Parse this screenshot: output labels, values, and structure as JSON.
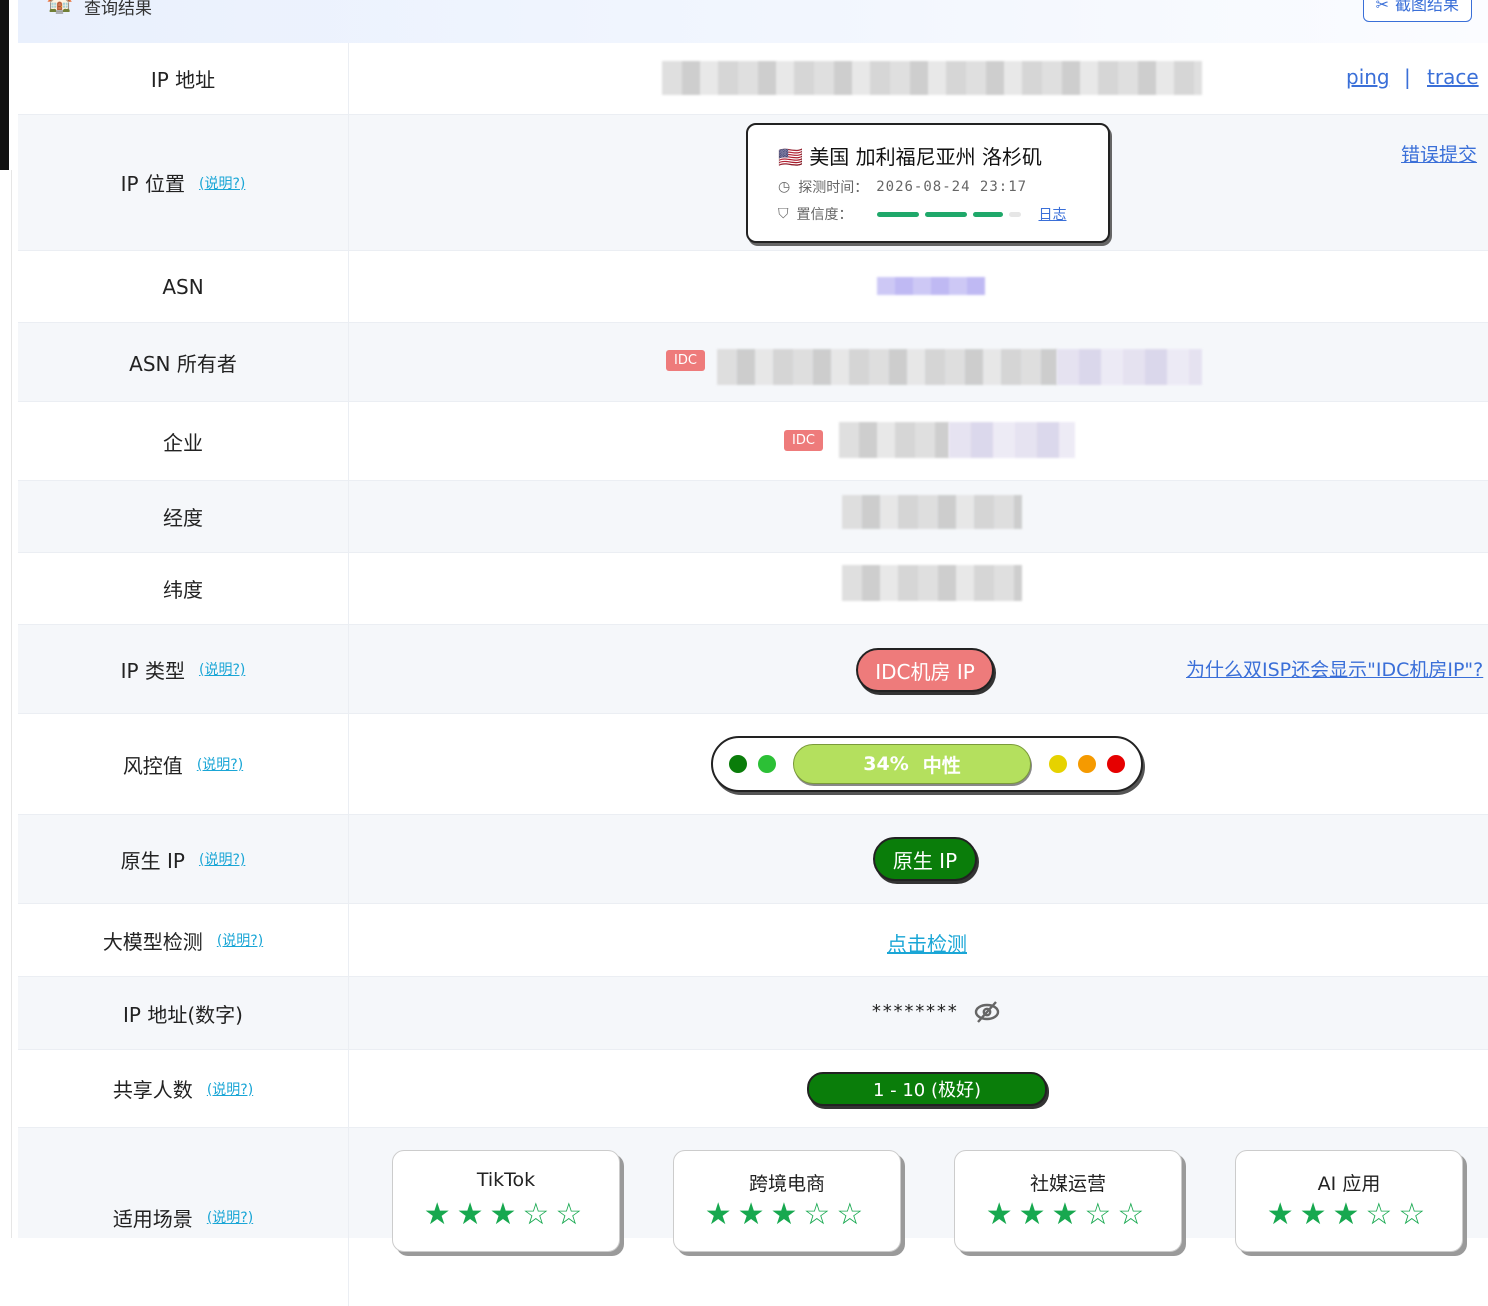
{
  "header": {
    "title": "查询结果",
    "screenshot_button": "截图结果"
  },
  "rows": {
    "ip": {
      "label": "IP 地址",
      "ping": "ping",
      "separator": "|",
      "trace": "trace"
    },
    "location": {
      "label": "IP 位置",
      "help": "(说明?)",
      "flag": "🇺🇸",
      "place": "美国 加利福尼亚州 洛杉矶",
      "detect_label": "探测时间：",
      "detect_time": "2026-08-24 23:17",
      "confidence_label": "置信度：",
      "log": "日志",
      "report": "错误提交"
    },
    "asn": {
      "label": "ASN"
    },
    "asn_owner": {
      "label": "ASN 所有者",
      "tag": "IDC"
    },
    "company": {
      "label": "企业",
      "tag": "IDC"
    },
    "longitude": {
      "label": "经度"
    },
    "latitude": {
      "label": "纬度"
    },
    "ip_type": {
      "label": "IP 类型",
      "help": "(说明?)",
      "value": "IDC机房 IP",
      "why": "为什么双ISP还会显示\"IDC机房IP\"?"
    },
    "risk": {
      "label": "风控值",
      "help": "(说明?)",
      "percent": "34%",
      "level": "中性",
      "score": 0.34
    },
    "native": {
      "label": "原生 IP",
      "help": "(说明?)",
      "value": "原生 IP"
    },
    "llm": {
      "label": "大模型检测",
      "help": "(说明?)",
      "action": "点击检测"
    },
    "ip_num": {
      "label": "IP 地址(数字)",
      "masked": "********"
    },
    "shared": {
      "label": "共享人数",
      "help": "(说明?)",
      "value": "1 - 10 (极好)"
    },
    "scenes": {
      "label": "适用场景",
      "help": "(说明?)",
      "items": [
        {
          "name": "TikTok",
          "stars": "★★★☆☆",
          "rating": 3
        },
        {
          "name": "跨境电商",
          "stars": "★★★☆☆",
          "rating": 3
        },
        {
          "name": "社媒运营",
          "stars": "★★★☆☆",
          "rating": 3
        },
        {
          "name": "AI 应用",
          "stars": "★★★☆☆",
          "rating": 3
        }
      ]
    }
  },
  "colors": {
    "link": "#3a6fd8",
    "help": "#1aa6d6",
    "idc": "#ee7b7b",
    "good": "#0a7d0a",
    "risk_bar": "#b4e05e",
    "star": "#17a84f"
  },
  "icons": [
    "house-icon",
    "scissors-icon",
    "clock-icon",
    "shield-check-icon",
    "eye-off-icon"
  ]
}
